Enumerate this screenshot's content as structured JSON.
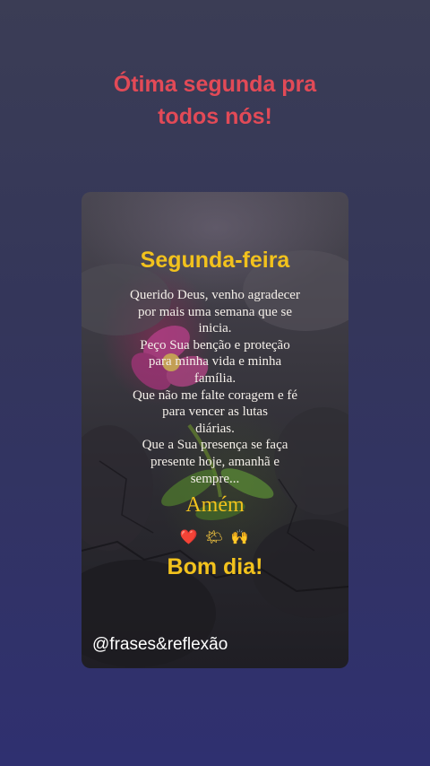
{
  "headline": {
    "line1": "Ótima segunda pra",
    "line2": "todos nós!"
  },
  "card": {
    "title": "Segunda-feira",
    "prayer_lines": [
      "Querido Deus, venho agradecer",
      "por mais uma semana que se",
      "inicia.",
      "Peço Sua benção e proteção",
      "para minha vida e minha",
      "família.",
      "Que não me falte coragem e fé",
      "para vencer as lutas",
      "diárias.",
      "Que a Sua presença se faça",
      "presente hoje, amanhã e",
      "sempre..."
    ],
    "amen": "Amém",
    "emojis": {
      "heart": "❤️",
      "sun": "🌤",
      "hands": "🙌"
    },
    "greeting": "Bom dia!",
    "handle": "@frases&reflexão"
  },
  "colors": {
    "headline": "#e24a57",
    "accent_yellow": "#f2c21d",
    "prayer_text": "#f4efe9",
    "background": "#34365a"
  }
}
